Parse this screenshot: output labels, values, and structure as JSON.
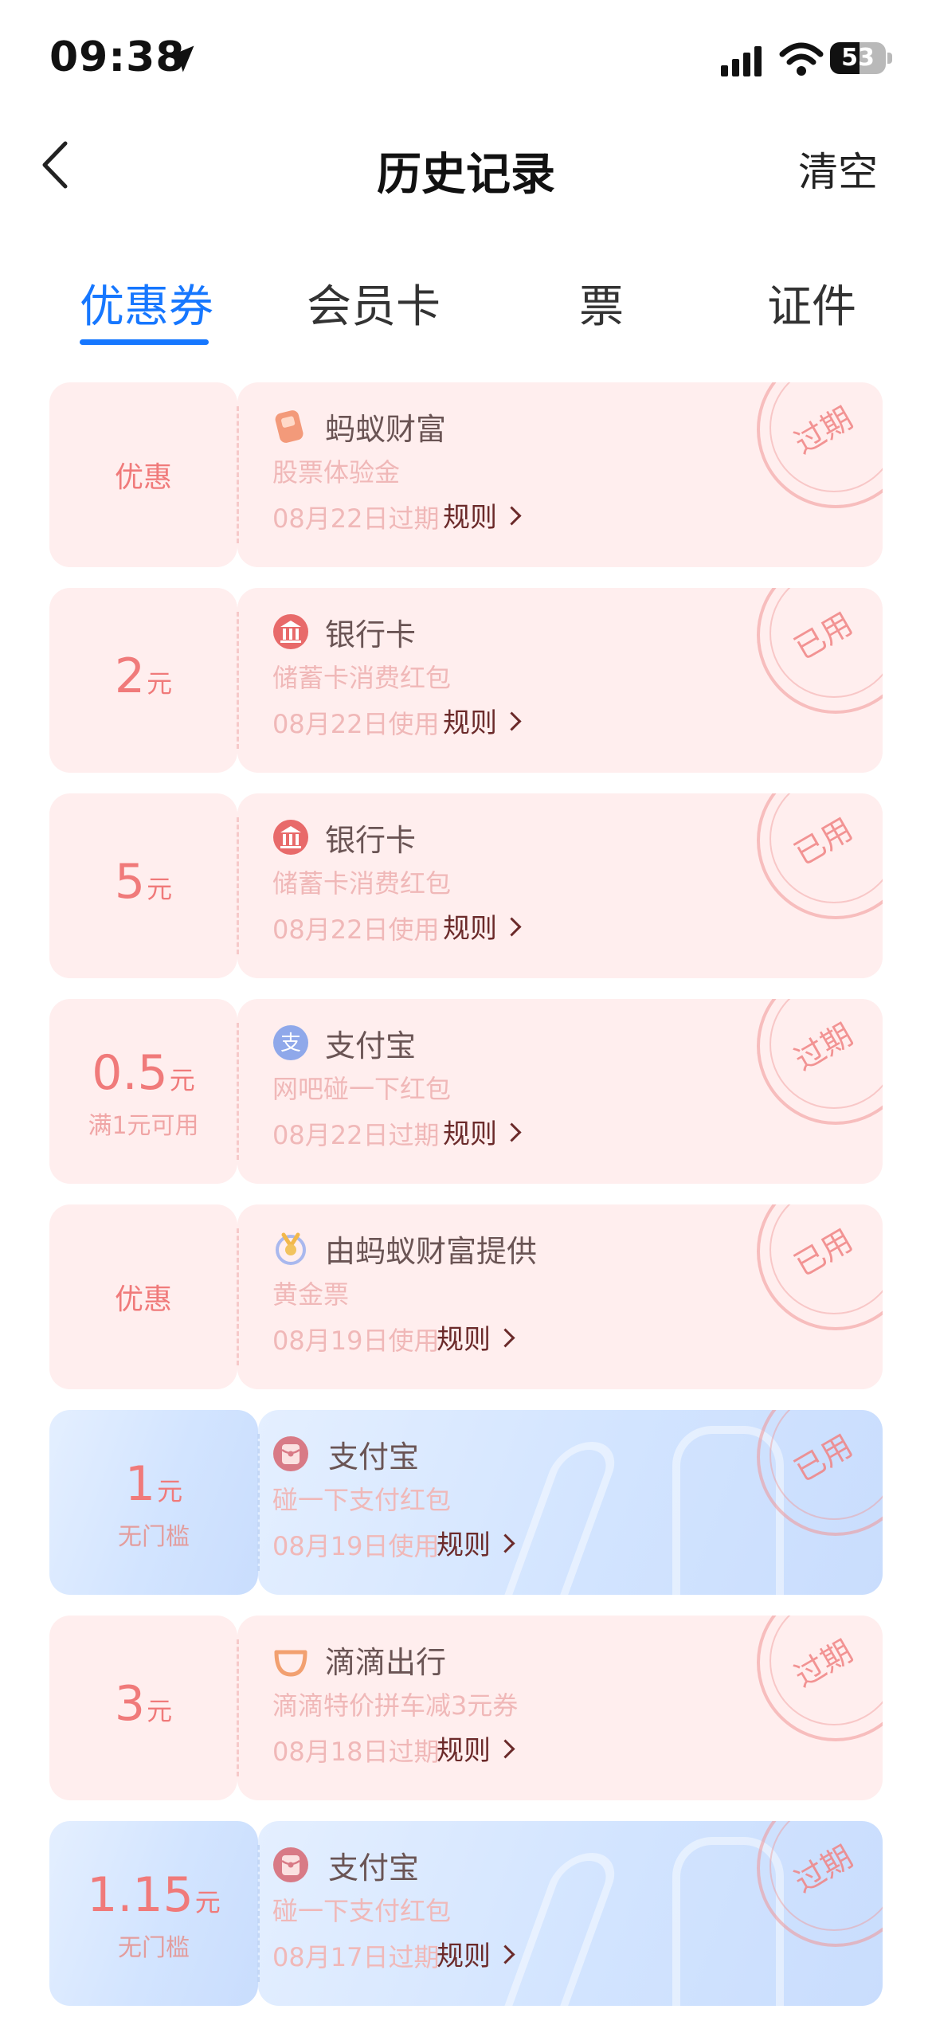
{
  "status": {
    "time": "09:38",
    "battery_level": "53",
    "battery_fraction": 0.53
  },
  "nav": {
    "title": "历史记录",
    "clear_label": "清空"
  },
  "tabs": [
    {
      "label": "优惠券",
      "active": true
    },
    {
      "label": "会员卡",
      "active": false
    },
    {
      "label": "票",
      "active": false
    },
    {
      "label": "证件",
      "active": false
    }
  ],
  "coupons": [
    {
      "amount": "",
      "unit": "",
      "amount_text": "优惠",
      "sub": "",
      "brand": "蚂蚁财富",
      "brand_icon": "ant-fortune-icon",
      "desc": "股票体验金",
      "date": "08月22日过期",
      "rule": "规则",
      "stamp": "过期",
      "style": "pink"
    },
    {
      "amount": "2",
      "unit": "元",
      "amount_text": "",
      "sub": "",
      "brand": "银行卡",
      "brand_icon": "bank-icon",
      "desc": "储蓄卡消费红包",
      "date": "08月22日使用",
      "rule": "规则",
      "stamp": "已用",
      "style": "pink"
    },
    {
      "amount": "5",
      "unit": "元",
      "amount_text": "",
      "sub": "",
      "brand": "银行卡",
      "brand_icon": "bank-icon",
      "desc": "储蓄卡消费红包",
      "date": "08月22日使用",
      "rule": "规则",
      "stamp": "已用",
      "style": "pink"
    },
    {
      "amount": "0.5",
      "unit": "元",
      "amount_text": "",
      "sub": "满1元可用",
      "brand": "支付宝",
      "brand_icon": "alipay-icon",
      "desc": "网吧碰一下红包",
      "date": "08月22日过期",
      "rule": "规则",
      "stamp": "过期",
      "style": "pink"
    },
    {
      "amount": "",
      "unit": "",
      "amount_text": "优惠",
      "sub": "",
      "brand": "由蚂蚁财富提供",
      "brand_icon": "gold-ticket-icon",
      "desc": "黄金票",
      "date": "08月19日使用",
      "rule": "规则",
      "stamp": "已用",
      "style": "pink"
    },
    {
      "amount": "1",
      "unit": "元",
      "amount_text": "",
      "sub": "无门槛",
      "brand": "支付宝",
      "brand_icon": "red-packet-icon",
      "desc": "碰一下支付红包",
      "date": "08月19日使用",
      "rule": "规则",
      "stamp": "已用",
      "style": "blue"
    },
    {
      "amount": "3",
      "unit": "元",
      "amount_text": "",
      "sub": "",
      "brand": "滴滴出行",
      "brand_icon": "didi-icon",
      "desc": "滴滴特价拼车减3元券",
      "date": "08月18日过期",
      "rule": "规则",
      "stamp": "过期",
      "style": "pink"
    },
    {
      "amount": "1.15",
      "unit": "元",
      "amount_text": "",
      "sub": "无门槛",
      "brand": "支付宝",
      "brand_icon": "red-packet-icon",
      "desc": "碰一下支付红包",
      "date": "08月17日过期",
      "rule": "规则",
      "stamp": "过期",
      "style": "blue"
    }
  ]
}
